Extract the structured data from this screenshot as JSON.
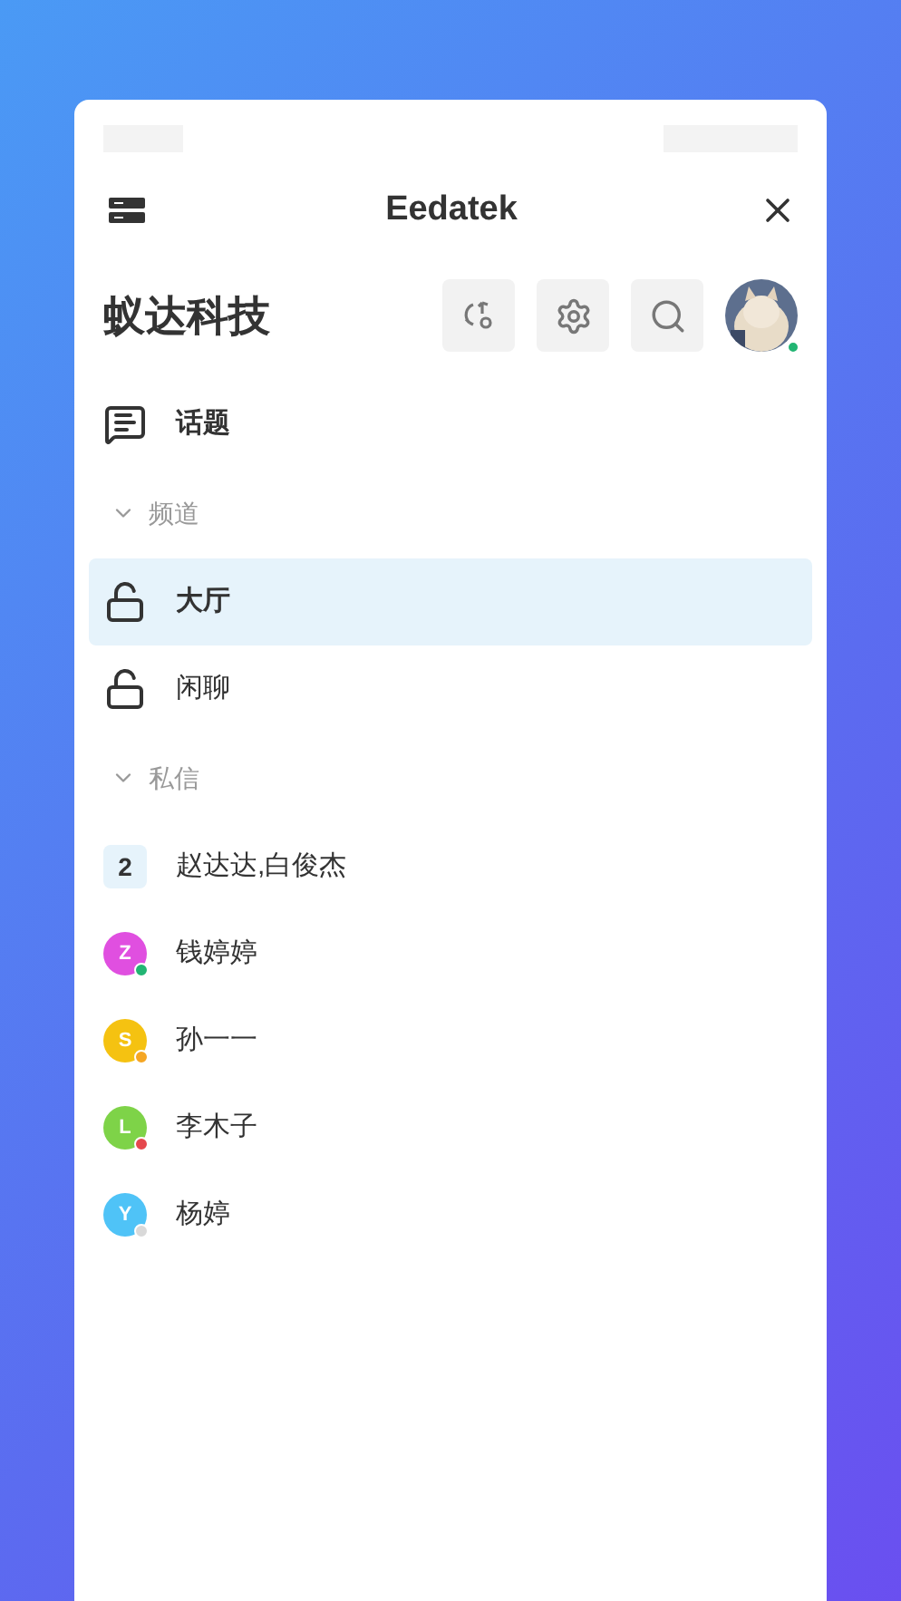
{
  "header": {
    "title": "Eedatek"
  },
  "org": {
    "name": "蚁达科技",
    "status": {
      "color": "#22b573"
    }
  },
  "topics": {
    "label": "话题",
    "selected": false
  },
  "sections": [
    {
      "label": "频道",
      "expanded": true,
      "items": [
        {
          "kind": "channel",
          "label": "大厅",
          "selected": true
        },
        {
          "kind": "channel",
          "label": "闲聊",
          "selected": false
        }
      ]
    },
    {
      "label": "私信",
      "expanded": true,
      "items": [
        {
          "kind": "group",
          "label": "赵达达,白俊杰",
          "count": "2",
          "selected": false
        },
        {
          "kind": "user",
          "label": "钱婷婷",
          "letter": "Z",
          "color": "#e04fe0",
          "status": {
            "color": "#22b573"
          },
          "selected": false
        },
        {
          "kind": "user",
          "label": "孙一一",
          "letter": "S",
          "color": "#f5c211",
          "status": {
            "color": "#f5a623"
          },
          "selected": false
        },
        {
          "kind": "user",
          "label": "李木子",
          "letter": "L",
          "color": "#7ed348",
          "status": {
            "color": "#e5484d"
          },
          "selected": false
        },
        {
          "kind": "user",
          "label": "杨婷",
          "letter": "Y",
          "color": "#4fc3f7",
          "status": {
            "color": "#d9d9d9"
          },
          "selected": false
        }
      ]
    }
  ]
}
